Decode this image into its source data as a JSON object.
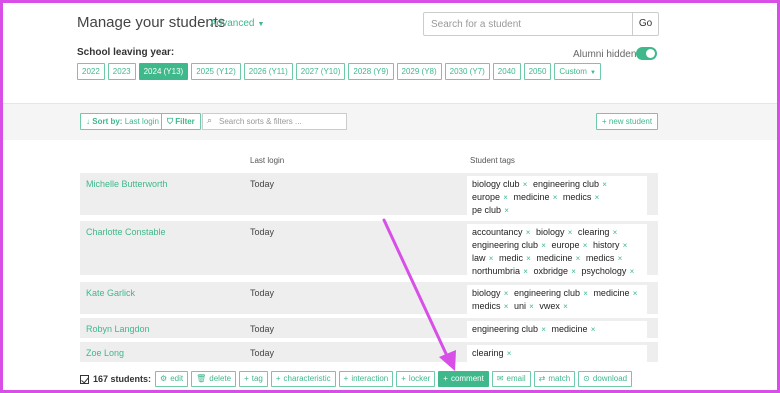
{
  "header": {
    "title": "Manage your students",
    "advanced_label": "Advanced",
    "search": {
      "placeholder": "Search for a student",
      "button_label": "Go"
    },
    "school_leaving_year_label": "School leaving year:",
    "alumni_label": "Alumni hidden",
    "alumni_toggle_on": true,
    "years": [
      {
        "label": "2022",
        "active": false
      },
      {
        "label": "2023",
        "active": false
      },
      {
        "label": "2024 (Y13)",
        "active": true
      },
      {
        "label": "2025 (Y12)",
        "active": false
      },
      {
        "label": "2026 (Y11)",
        "active": false
      },
      {
        "label": "2027 (Y10)",
        "active": false
      },
      {
        "label": "2028 (Y9)",
        "active": false
      },
      {
        "label": "2029 (Y8)",
        "active": false
      },
      {
        "label": "2030 (Y7)",
        "active": false
      },
      {
        "label": "2040",
        "active": false
      },
      {
        "label": "2050",
        "active": false
      },
      {
        "label": "Custom",
        "active": false
      }
    ]
  },
  "toolbar": {
    "sort_prefix": "Sort by:",
    "sort_value": "Last login",
    "filter_label": "Filter",
    "sortfilter_placeholder": "Search sorts & filters ...",
    "new_student_label": "+ new student"
  },
  "table": {
    "columns": [
      "Last login",
      "Student tags"
    ],
    "rows": [
      {
        "name": "Michelle Butterworth",
        "last_login": "Today",
        "tags": [
          "biology club",
          "engineering club",
          "europe",
          "medicine",
          "medics",
          "pe club"
        ]
      },
      {
        "name": "Charlotte Constable",
        "last_login": "Today",
        "tags": [
          "accountancy",
          "biology",
          "clearing",
          "engineering club",
          "europe",
          "history",
          "law",
          "medic",
          "medicine",
          "medics",
          "northumbria",
          "oxbridge",
          "psychology"
        ]
      },
      {
        "name": "Kate Garlick",
        "last_login": "Today",
        "tags": [
          "biology",
          "engineering club",
          "medicine",
          "medics",
          "uni",
          "vwex"
        ]
      },
      {
        "name": "Robyn Langdon",
        "last_login": "Today",
        "tags": [
          "engineering club",
          "medicine"
        ]
      },
      {
        "name": "Zoe Long",
        "last_login": "Today",
        "tags": [
          "clearing"
        ]
      }
    ]
  },
  "bottom_bar": {
    "count_label": "167 students:",
    "actions": [
      {
        "label": "edit",
        "icon": "gear-icon",
        "glyph": "⚙",
        "active": false
      },
      {
        "label": "delete",
        "icon": "trash-icon",
        "glyph": "🗑",
        "active": false
      },
      {
        "label": "tag",
        "icon": "plus-icon",
        "glyph": "+",
        "active": false
      },
      {
        "label": "characteristic",
        "icon": "plus-icon",
        "glyph": "+",
        "active": false
      },
      {
        "label": "interaction",
        "icon": "plus-icon",
        "glyph": "+",
        "active": false
      },
      {
        "label": "locker",
        "icon": "plus-icon",
        "glyph": "+",
        "active": false
      },
      {
        "label": "comment",
        "icon": "plus-icon",
        "glyph": "+",
        "active": true
      },
      {
        "label": "email",
        "icon": "envelope-icon",
        "glyph": "✉",
        "active": false
      },
      {
        "label": "match",
        "icon": "shuffle-icon",
        "glyph": "⇄",
        "active": false
      },
      {
        "label": "download",
        "icon": "download-icon",
        "glyph": "⊙",
        "active": false
      }
    ]
  },
  "colors": {
    "accent": "#3fb88b",
    "annotation": "#d84fe8",
    "frame": "#d84fe8"
  }
}
